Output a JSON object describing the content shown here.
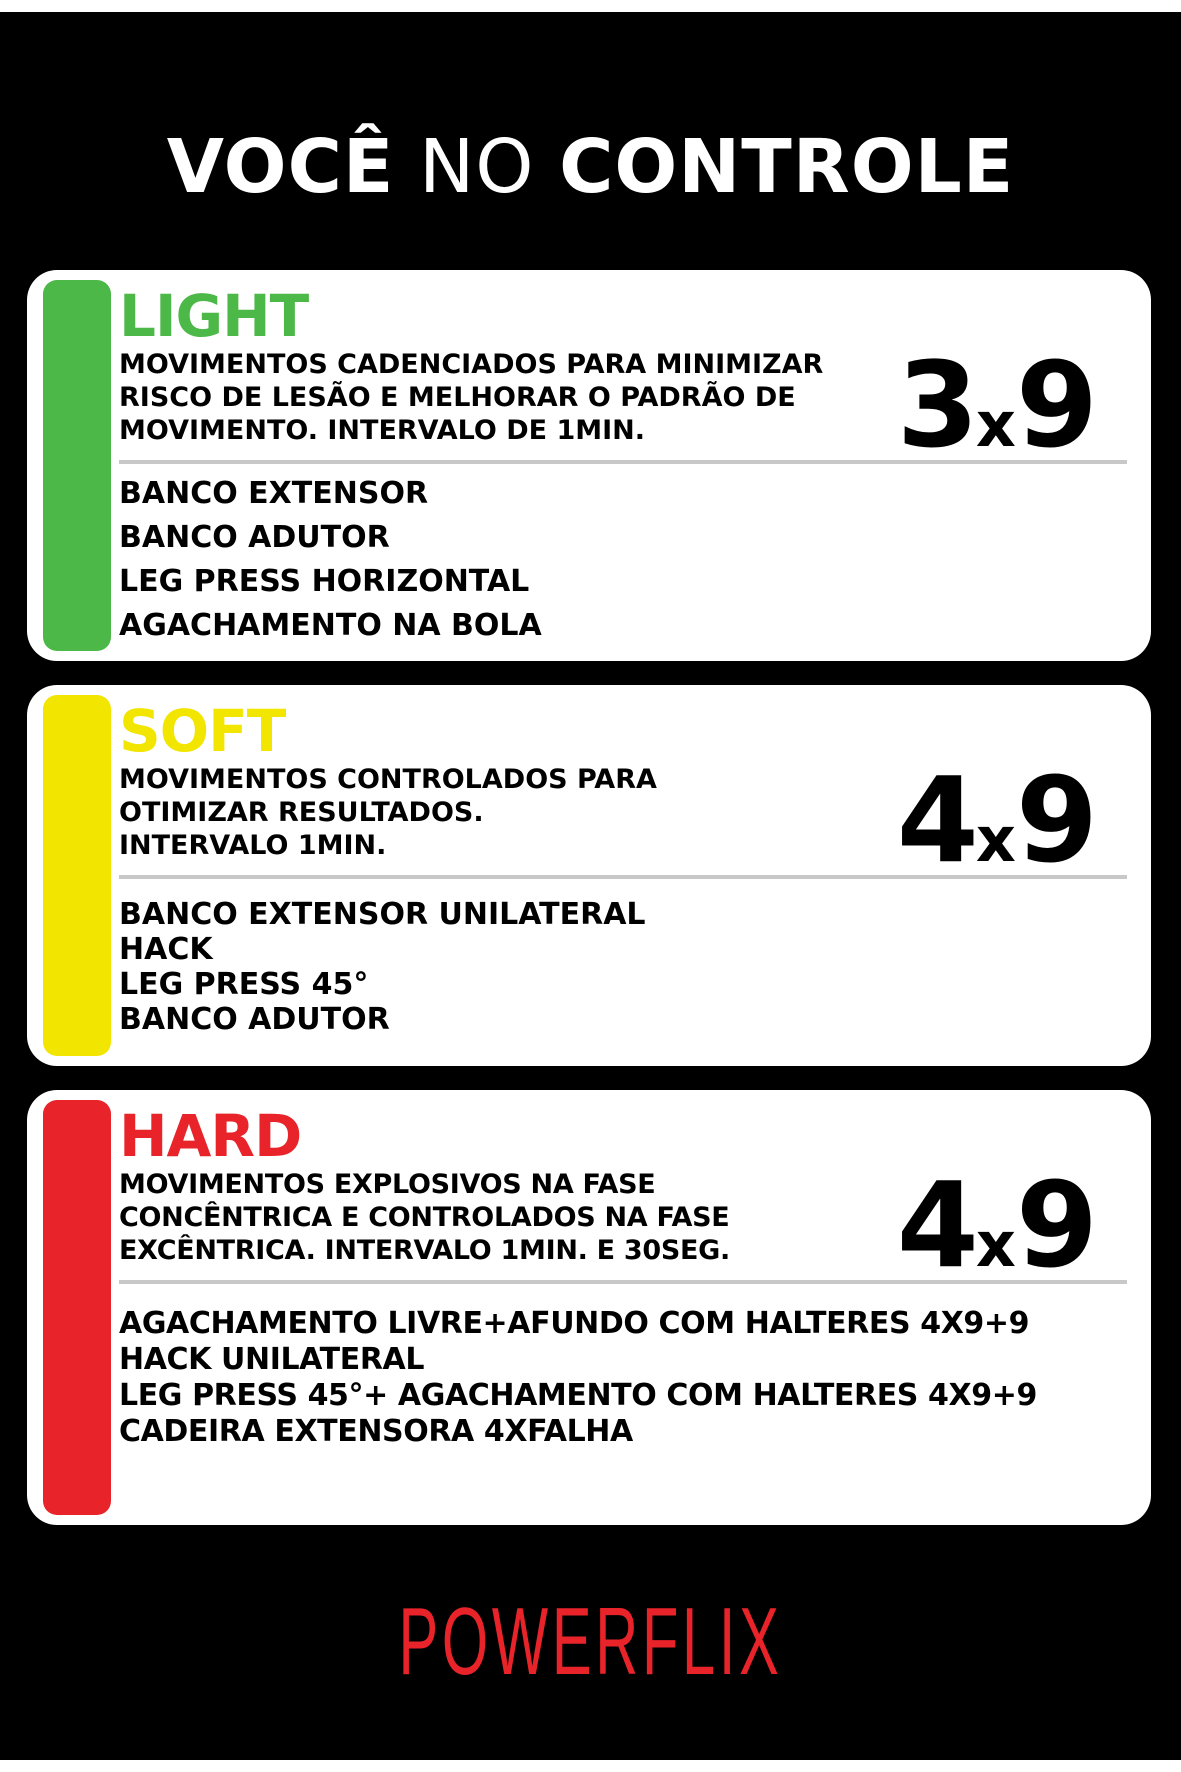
{
  "title": {
    "part1": "VOCÊ",
    "part2": "NO",
    "part3": "CONTROLE"
  },
  "colors": {
    "background": "#000000",
    "card": "#ffffff",
    "light": "#4cb848",
    "soft": "#f2e500",
    "hard": "#e8232a",
    "brand": "#e8232a"
  },
  "cards": [
    {
      "name": "LIGHT",
      "description": [
        "MOVIMENTOS CADENCIADOS PARA MINIMIZAR",
        "RISCO DE LESÃO E MELHORAR O PADRÃO DE",
        "MOVIMENTO. INTERVALO DE 1MIN."
      ],
      "sets": "3",
      "separator": "x",
      "reps": "9",
      "exercises": [
        "BANCO EXTENSOR",
        "BANCO ADUTOR",
        "LEG PRESS HORIZONTAL",
        "AGACHAMENTO NA BOLA"
      ]
    },
    {
      "name": "SOFT",
      "description": [
        "MOVIMENTOS CONTROLADOS PARA",
        "OTIMIZAR RESULTADOS.",
        "INTERVALO 1MIN."
      ],
      "sets": "4",
      "separator": "x",
      "reps": "9",
      "exercises": [
        "BANCO EXTENSOR UNILATERAL",
        "HACK",
        "LEG PRESS 45°",
        "BANCO ADUTOR"
      ]
    },
    {
      "name": "HARD",
      "description": [
        "MOVIMENTOS EXPLOSIVOS NA FASE",
        "CONCÊNTRICA E CONTROLADOS NA FASE",
        "EXCÊNTRICA. INTERVALO 1MIN. E 30SEG."
      ],
      "sets": "4",
      "separator": "x",
      "reps": "9",
      "exercises": [
        "AGACHAMENTO LIVRE+AFUNDO COM HALTERES 4X9+9",
        "HACK UNILATERAL",
        "LEG PRESS 45°+ AGACHAMENTO COM HALTERES 4X9+9",
        "CADEIRA EXTENSORA 4XFALHA"
      ]
    }
  ],
  "brand": "POWERFLIX"
}
